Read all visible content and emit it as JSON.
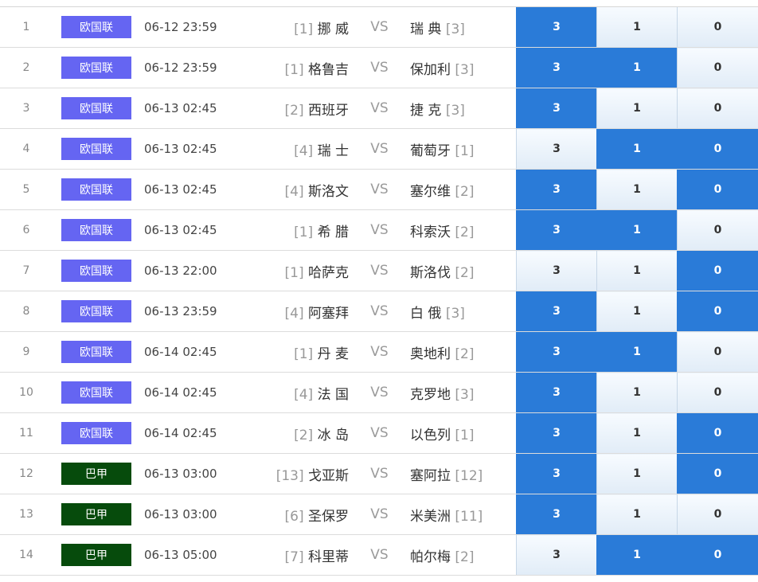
{
  "colors": {
    "euro_badge": "#6565f2",
    "brazil_badge": "#064b0c",
    "selected_odd_bg": "#2a7bd8",
    "odd_bg": "#e8f1fa"
  },
  "matches": [
    {
      "num": "1",
      "league": "欧国联",
      "league_type": "euro",
      "time": "06-12 23:59",
      "home_rank": "[1]",
      "home": "挪 威",
      "vs": "VS",
      "away": "瑞 典",
      "away_rank": "[3]",
      "odds": [
        "3",
        "1",
        "0"
      ],
      "selected": [
        true,
        false,
        false
      ]
    },
    {
      "num": "2",
      "league": "欧国联",
      "league_type": "euro",
      "time": "06-12 23:59",
      "home_rank": "[1]",
      "home": "格鲁吉",
      "vs": "VS",
      "away": "保加利",
      "away_rank": "[3]",
      "odds": [
        "3",
        "1",
        "0"
      ],
      "selected": [
        true,
        true,
        false
      ]
    },
    {
      "num": "3",
      "league": "欧国联",
      "league_type": "euro",
      "time": "06-13 02:45",
      "home_rank": "[2]",
      "home": "西班牙",
      "vs": "VS",
      "away": "捷 克",
      "away_rank": "[3]",
      "odds": [
        "3",
        "1",
        "0"
      ],
      "selected": [
        true,
        false,
        false
      ]
    },
    {
      "num": "4",
      "league": "欧国联",
      "league_type": "euro",
      "time": "06-13 02:45",
      "home_rank": "[4]",
      "home": "瑞 士",
      "vs": "VS",
      "away": "葡萄牙",
      "away_rank": "[1]",
      "odds": [
        "3",
        "1",
        "0"
      ],
      "selected": [
        false,
        true,
        true
      ]
    },
    {
      "num": "5",
      "league": "欧国联",
      "league_type": "euro",
      "time": "06-13 02:45",
      "home_rank": "[4]",
      "home": "斯洛文",
      "vs": "VS",
      "away": "塞尔维",
      "away_rank": "[2]",
      "odds": [
        "3",
        "1",
        "0"
      ],
      "selected": [
        true,
        false,
        true
      ]
    },
    {
      "num": "6",
      "league": "欧国联",
      "league_type": "euro",
      "time": "06-13 02:45",
      "home_rank": "[1]",
      "home": "希 腊",
      "vs": "VS",
      "away": "科索沃",
      "away_rank": "[2]",
      "odds": [
        "3",
        "1",
        "0"
      ],
      "selected": [
        true,
        true,
        false
      ]
    },
    {
      "num": "7",
      "league": "欧国联",
      "league_type": "euro",
      "time": "06-13 22:00",
      "home_rank": "[1]",
      "home": "哈萨克",
      "vs": "VS",
      "away": "斯洛伐",
      "away_rank": "[2]",
      "odds": [
        "3",
        "1",
        "0"
      ],
      "selected": [
        false,
        false,
        true
      ]
    },
    {
      "num": "8",
      "league": "欧国联",
      "league_type": "euro",
      "time": "06-13 23:59",
      "home_rank": "[4]",
      "home": "阿塞拜",
      "vs": "VS",
      "away": "白 俄",
      "away_rank": "[3]",
      "odds": [
        "3",
        "1",
        "0"
      ],
      "selected": [
        true,
        false,
        true
      ]
    },
    {
      "num": "9",
      "league": "欧国联",
      "league_type": "euro",
      "time": "06-14 02:45",
      "home_rank": "[1]",
      "home": "丹 麦",
      "vs": "VS",
      "away": "奥地利",
      "away_rank": "[2]",
      "odds": [
        "3",
        "1",
        "0"
      ],
      "selected": [
        true,
        true,
        false
      ]
    },
    {
      "num": "10",
      "league": "欧国联",
      "league_type": "euro",
      "time": "06-14 02:45",
      "home_rank": "[4]",
      "home": "法 国",
      "vs": "VS",
      "away": "克罗地",
      "away_rank": "[3]",
      "odds": [
        "3",
        "1",
        "0"
      ],
      "selected": [
        true,
        false,
        false
      ]
    },
    {
      "num": "11",
      "league": "欧国联",
      "league_type": "euro",
      "time": "06-14 02:45",
      "home_rank": "[2]",
      "home": "冰 岛",
      "vs": "VS",
      "away": "以色列",
      "away_rank": "[1]",
      "odds": [
        "3",
        "1",
        "0"
      ],
      "selected": [
        true,
        false,
        true
      ]
    },
    {
      "num": "12",
      "league": "巴甲",
      "league_type": "brazil",
      "time": "06-13 03:00",
      "home_rank": "[13]",
      "home": "戈亚斯",
      "vs": "VS",
      "away": "塞阿拉",
      "away_rank": "[12]",
      "odds": [
        "3",
        "1",
        "0"
      ],
      "selected": [
        true,
        false,
        true
      ]
    },
    {
      "num": "13",
      "league": "巴甲",
      "league_type": "brazil",
      "time": "06-13 03:00",
      "home_rank": "[6]",
      "home": "圣保罗",
      "vs": "VS",
      "away": "米美洲",
      "away_rank": "[11]",
      "odds": [
        "3",
        "1",
        "0"
      ],
      "selected": [
        true,
        false,
        false
      ]
    },
    {
      "num": "14",
      "league": "巴甲",
      "league_type": "brazil",
      "time": "06-13 05:00",
      "home_rank": "[7]",
      "home": "科里蒂",
      "vs": "VS",
      "away": "帕尔梅",
      "away_rank": "[2]",
      "odds": [
        "3",
        "1",
        "0"
      ],
      "selected": [
        false,
        true,
        true
      ]
    }
  ]
}
